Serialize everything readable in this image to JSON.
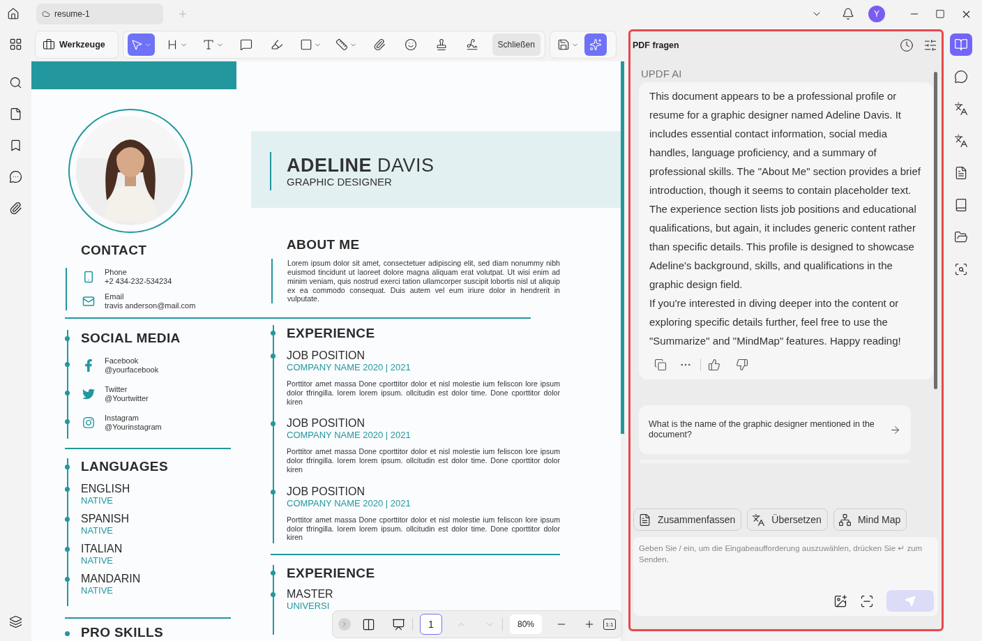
{
  "tab": {
    "title": "resume-1"
  },
  "user": {
    "initial": "Y"
  },
  "toolbar": {
    "tools_label": "Werkzeuge",
    "close_label": "Schließen",
    "tools": [
      {
        "kind": "pointer",
        "selected": true,
        "dropdown": true
      },
      {
        "kind": "heading",
        "selected": false,
        "dropdown": true
      },
      {
        "kind": "text",
        "selected": false,
        "dropdown": true
      },
      {
        "kind": "comment",
        "selected": false,
        "dropdown": false
      },
      {
        "kind": "highlighter",
        "selected": false,
        "dropdown": false
      },
      {
        "kind": "rectangle",
        "selected": false,
        "dropdown": true
      },
      {
        "kind": "ruler",
        "selected": false,
        "dropdown": true
      },
      {
        "kind": "attachment",
        "selected": false,
        "dropdown": false
      },
      {
        "kind": "emoji",
        "selected": false,
        "dropdown": false
      },
      {
        "kind": "stamp",
        "selected": false,
        "dropdown": false
      },
      {
        "kind": "signature",
        "selected": false,
        "dropdown": false
      }
    ],
    "extra": [
      {
        "kind": "save",
        "selected": false,
        "dropdown": true
      },
      {
        "kind": "ai",
        "selected": true,
        "dropdown": false
      }
    ]
  },
  "resume": {
    "name": "**ADELINE** DAVIS",
    "title": "GRAPHIC DESIGNER",
    "contact": {
      "heading": "CONTACT",
      "items": [
        {
          "kind": "phone",
          "label": "Phone",
          "value": "+2 434-232-534234"
        },
        {
          "kind": "email",
          "label": "Email",
          "value": "travis anderson@mail.com"
        }
      ]
    },
    "social": {
      "heading": "SOCIAL MEDIA",
      "items": [
        {
          "kind": "facebook",
          "label": "Facebook",
          "value": "@yourfacebook"
        },
        {
          "kind": "twitter",
          "label": "Twitter",
          "value": "@Yourtwitter"
        },
        {
          "kind": "instagram",
          "label": "Instagram",
          "value": "@Yourinstagram"
        }
      ]
    },
    "languages": {
      "heading": "LANGUAGES",
      "items": [
        {
          "name": "ENGLISH",
          "proficiency": "NATIVE"
        },
        {
          "name": "SPANISH",
          "proficiency": "NATIVE"
        },
        {
          "name": "ITALIAN",
          "proficiency": "NATIVE"
        },
        {
          "name": "MANDARIN",
          "proficiency": "NATIVE"
        }
      ]
    },
    "skills": {
      "heading": "PRO SKILLS"
    },
    "about": {
      "heading": "ABOUT ME",
      "text": "Lorem ipsum dolor sit amet, consectetuer adipiscing elit, sed diam nonummy nibh euismod tincidunt ut laoreet dolore magna aliquam erat volutpat. Ut wisi enim ad minim veniam, quis nostrud exerci tation ullamcorper suscipit lobortis nisl ut aliquip ex ea commodo consequat. Duis autem vel eum iriure dolor in hendrerit in vulputate."
    },
    "experience": {
      "heading": "EXPERIENCE",
      "jobs": [
        {
          "position": "JOB POSITION",
          "company": "COMPANY NAME 2020 | 2021",
          "description": "Porttitor amet massa Done cporttitor dolor et nisl molestie ium feliscon lore ipsum dolor tfringilla. lorem lorem ipsum. ollcitudin est dolor time. Done cporttitor dolor kiren"
        },
        {
          "position": "JOB POSITION",
          "company": "COMPANY NAME 2020 | 2021",
          "description": "Porttitor amet massa Done cporttitor dolor et nisl molestie ium feliscon lore ipsum dolor tfringilla. lorem lorem ipsum. ollcitudin est dolor time. Done cporttitor dolor kiren"
        },
        {
          "position": "JOB POSITION",
          "company": "COMPANY NAME 2020 | 2021",
          "description": "Porttitor amet massa Done cporttitor dolor et nisl molestie ium feliscon lore ipsum dolor tfringilla. lorem lorem ipsum. ollcitudin est dolor time. Done cporttitor dolor kiren"
        }
      ]
    },
    "education": {
      "heading": "EXPERIENCE",
      "entries": [
        {
          "degree": "MASTER",
          "school": "UNIVERSI"
        }
      ]
    }
  },
  "page_bar": {
    "page": "1",
    "zoom": "80%",
    "fit": "1:1"
  },
  "ai_panel": {
    "title": "PDF fragen",
    "sender": "UPDF AI",
    "paragraphs": [
      "This document appears to be a professional profile or resume for a graphic designer named Adeline Davis. It includes essential contact information, social media handles, language proficiency, and a summary of professional skills. The \"About Me\" section provides a brief introduction, though it seems to contain placeholder text.",
      "The experience section lists job positions and educational qualifications, but again, it includes generic content rather than specific details. This profile is designed to showcase Adeline's background, skills, and qualifications in the graphic design field.",
      "If you're interested in diving deeper into the content or exploring specific details further, feel free to use the \"Summarize\" and \"MindMap\" features. Happy reading!"
    ],
    "suggestion": "What is the name of the graphic designer mentioned in the document?",
    "actions": [
      {
        "kind": "summarize",
        "label": "Zusammenfassen"
      },
      {
        "kind": "translate",
        "label": "Übersetzen"
      },
      {
        "kind": "mindmap",
        "label": "Mind Map"
      }
    ],
    "input": {
      "placeholder": "Geben Sie / ein, um die Eingabeaufforderung auszuwählen, drücken Sie ↵ zum Senden."
    },
    "send": {
      "disabled": true
    }
  },
  "right_rail": [
    {
      "kind": "ask",
      "selected": true
    },
    {
      "kind": "chat",
      "selected": false
    },
    {
      "kind": "translate",
      "selected": false
    },
    {
      "kind": "explain",
      "selected": false
    },
    {
      "kind": "summary",
      "selected": false
    },
    {
      "kind": "book",
      "selected": false
    },
    {
      "kind": "folder",
      "selected": false
    },
    {
      "kind": "scan",
      "selected": false
    }
  ]
}
